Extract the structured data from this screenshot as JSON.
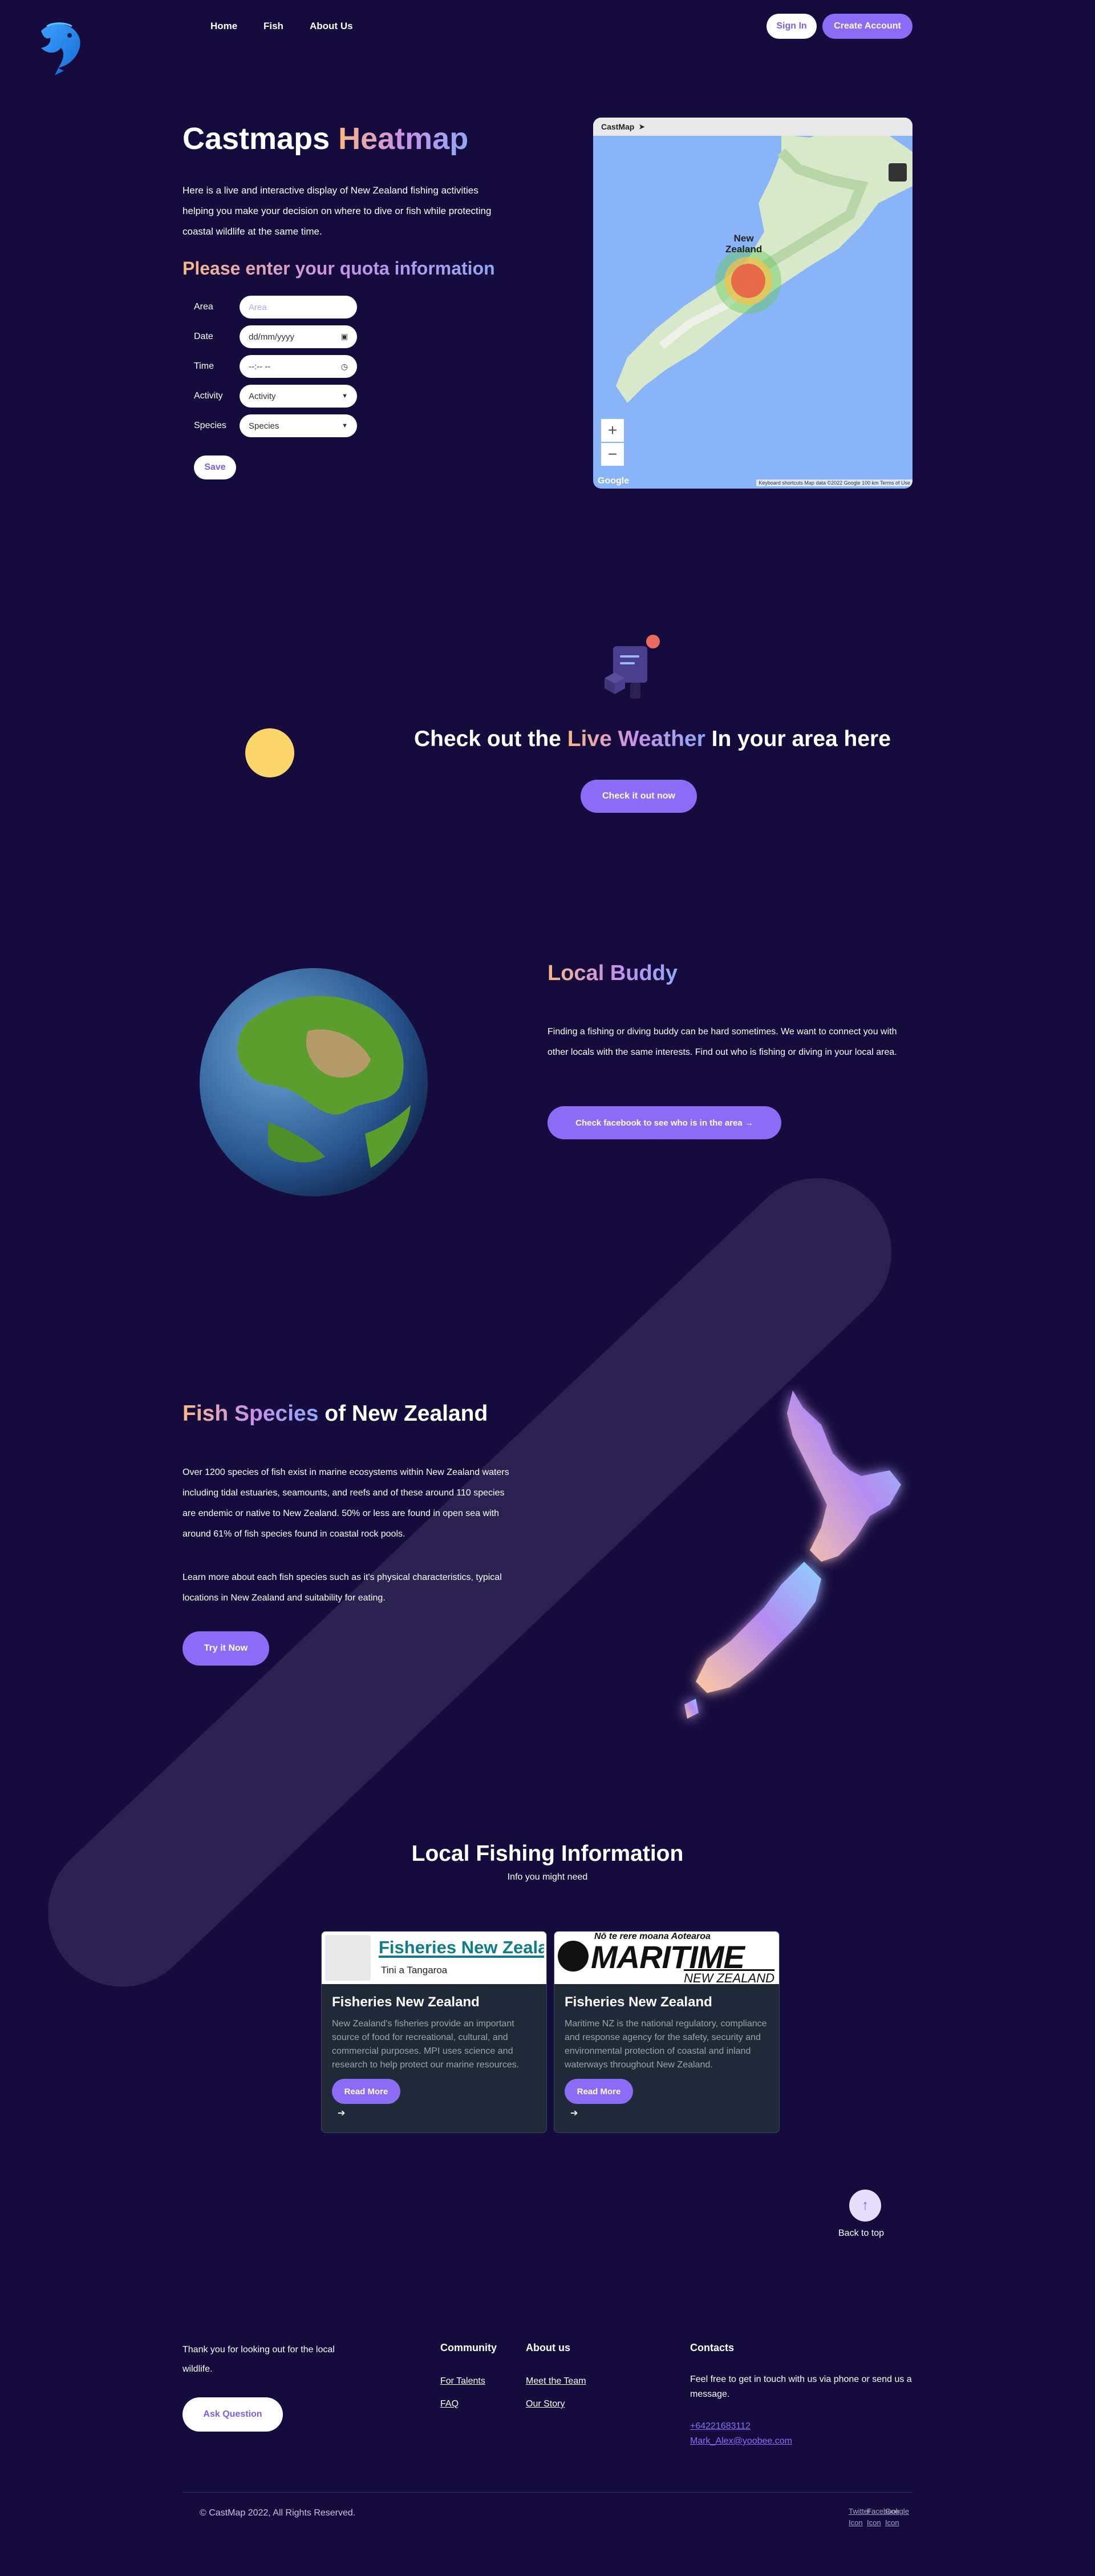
{
  "nav": {
    "home": "Home",
    "fish": "Fish",
    "about": "About Us",
    "sign_in": "Sign In",
    "create_account": "Create Account"
  },
  "heatmap": {
    "title_plain": "Castmaps",
    "title_accent": "Heatmap",
    "intro": "Here is a live and interactive display of New Zealand fishing activities helping you make your decision on where to dive or fish while protecting coastal wildlife at the same time.",
    "quota_title": "Please enter your quota information",
    "fields": {
      "area_label": "Area",
      "area_placeholder": "Area",
      "date_label": "Date",
      "date_value": "dd/mm/yyyy",
      "time_label": "Time",
      "time_value": "--:-- --",
      "activity_label": "Activity",
      "activity_value": "Activity",
      "species_label": "Species",
      "species_value": "Species"
    },
    "save": "Save",
    "map": {
      "bar_title": "CastMap",
      "bar_arrow": "➤",
      "country_label_1": "New",
      "country_label_2": "Zealand",
      "zoom_in": "+",
      "zoom_out": "−",
      "google": "Google",
      "attribution": "Keyboard shortcuts   Map data ©2022 Google   100 km   Terms of Use",
      "land_color": "#d7e9c9",
      "water_color": "#8ab4f8"
    }
  },
  "weather": {
    "title_before": "Check out the",
    "title_accent": "Live Weather",
    "title_after": "In your area here",
    "button": "Check it out now"
  },
  "buddy": {
    "title": "Local Buddy",
    "text": "Finding a fishing or diving buddy can be hard sometimes. We want to connect you with other locals with the same interests. Find out who is fishing or diving in your local area.",
    "button": "Check facebook to see who is in the area →"
  },
  "fish": {
    "title_accent": "Fish Species",
    "title_after": "of New Zealand",
    "text1": "Over 1200 species of fish exist in marine ecosystems within New Zealand waters including tidal estuaries, seamounts, and reefs and of these around 110 species are endemic or native to New Zealand. 50% or less are found in open sea with around 61% of fish species found in coastal rock pools.",
    "text2": "Learn more about each fish species such as it's physical characteristics, typical locations in New Zealand and suitability for eating.",
    "button": "Try it Now"
  },
  "local_info": {
    "title": "Local Fishing Information",
    "subtitle": "Info you might need",
    "cards": [
      {
        "logo_title": "Fisheries New Zealand",
        "logo_sub": "Tini a Tangaroa",
        "title": "Fisheries New Zealand",
        "text": "New Zealand's fisheries provide an important source of food for recreational, cultural, and commercial purposes. MPI uses science and research to help protect our marine resources.",
        "button": "Read More",
        "arrow": "➔"
      },
      {
        "logo_top": "Nō te rere moana Aotearoa",
        "logo_title": "MARITIME",
        "logo_sub": "NEW ZEALAND",
        "title": "Fisheries New Zealand",
        "text": "Maritime NZ is the national regulatory, compliance and response agency for the safety, security and environmental protection of coastal and inland waterways throughout New Zealand.",
        "button": "Read More",
        "arrow": "➔"
      }
    ]
  },
  "back_to_top": {
    "icon": "↑",
    "label": "Back to top"
  },
  "footer": {
    "thanks": "Thank you for looking out for the local wildlife.",
    "ask": "Ask Question",
    "community_heading": "Community",
    "community_links": [
      "For Talents",
      "FAQ"
    ],
    "about_heading": "About us",
    "about_links": [
      "Meet the Team",
      "Our Story"
    ],
    "contact_heading": "Contacts",
    "contact_text": "Feel free to get in touch with us via phone or send us a message.",
    "phone": "+64221683112",
    "email": "Mark_Alex@yoobee.com",
    "copyright": "© CastMap 2022, All Rights Reserved.",
    "social": [
      "Twitter Icon",
      "Facebook Icon",
      "Google Icon"
    ]
  },
  "colors": {
    "background": "#160b3d",
    "accent_purple": "#8b6cf6",
    "stripe": "#2b2150",
    "sun": "#fad66b"
  }
}
